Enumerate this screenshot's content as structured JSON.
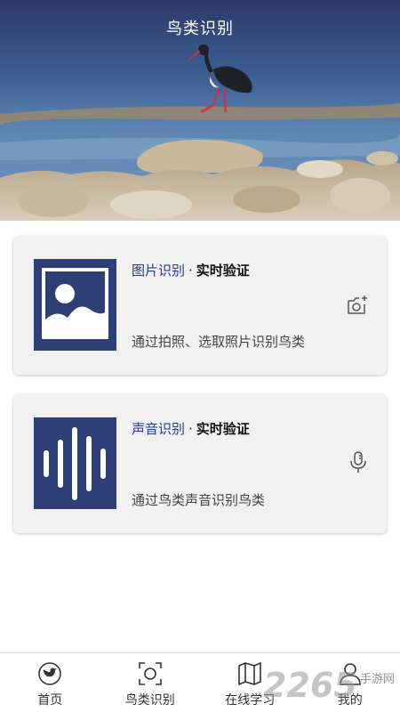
{
  "header": {
    "title": "鸟类识别"
  },
  "cards": [
    {
      "title_highlight": "图片识别",
      "separator": "·",
      "title_sub": "实时验证",
      "description": "通过拍照、选取照片识别鸟类",
      "thumb_icon": "image-icon",
      "action_icon": "camera-add-icon"
    },
    {
      "title_highlight": "声音识别",
      "separator": "·",
      "title_sub": "实时验证",
      "description": "通过鸟类声音识别鸟类",
      "thumb_icon": "soundwave-icon",
      "action_icon": "microphone-icon"
    }
  ],
  "tabbar": {
    "items": [
      {
        "label": "首页",
        "icon": "twitter-bird-icon"
      },
      {
        "label": "鸟类识别",
        "icon": "scan-icon"
      },
      {
        "label": "在线学习",
        "icon": "map-icon"
      },
      {
        "label": "我的",
        "icon": "user-icon"
      }
    ]
  },
  "watermark": {
    "number": "2265",
    "text": "手游网"
  },
  "colors": {
    "accent": "#233a9a",
    "thumb_bg": "#2e3f78",
    "card_bg": "#f1f1f1"
  }
}
